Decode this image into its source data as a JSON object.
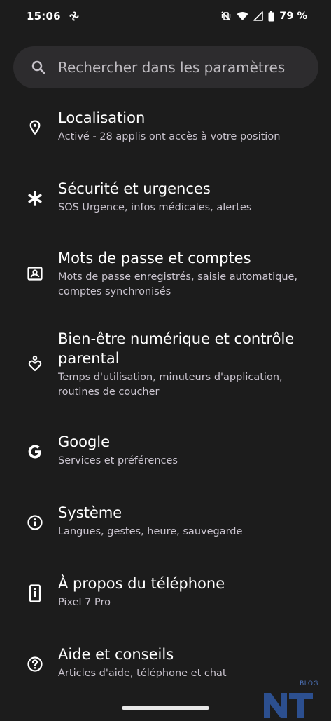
{
  "status_bar": {
    "time": "15:06",
    "battery": "79 %",
    "icons": [
      "fan-notification-icon",
      "vibrate-off-icon",
      "wifi-icon",
      "signal-icon",
      "battery-icon"
    ]
  },
  "search": {
    "placeholder": "Rechercher dans les paramètres"
  },
  "settings": [
    {
      "title": "Localisation",
      "subtitle": "Activé - 28 applis ont accès à votre position",
      "icon": "location-pin-icon"
    },
    {
      "title": "Sécurité et urgences",
      "subtitle": "SOS Urgence, infos médicales, alertes",
      "icon": "asterisk-icon"
    },
    {
      "title": "Mots de passe et comptes",
      "subtitle": "Mots de passe enregistrés, saisie automatique, comptes synchronisés",
      "icon": "account-box-icon"
    },
    {
      "title": "Bien-être numérique et contrôle parental",
      "subtitle": "Temps d'utilisation, minuteurs d'application, routines de coucher",
      "icon": "wellbeing-heart-icon"
    },
    {
      "title": "Google",
      "subtitle": "Services et préférences",
      "icon": "google-g-icon"
    },
    {
      "title": "Système",
      "subtitle": "Langues, gestes, heure, sauvegarde",
      "icon": "info-icon"
    },
    {
      "title": "À propos du téléphone",
      "subtitle": "Pixel 7 Pro",
      "icon": "phone-info-icon"
    },
    {
      "title": "Aide et conseils",
      "subtitle": "Articles d'aide, téléphone et chat",
      "icon": "help-icon"
    }
  ],
  "watermark": {
    "logo": "NT",
    "label": "BLOG"
  },
  "colors": {
    "background": "#1c1c1c",
    "search_background": "#2d2c2e",
    "title": "#ffffff",
    "subtitle": "#cac4cf",
    "watermark": "#2c4f8f"
  }
}
